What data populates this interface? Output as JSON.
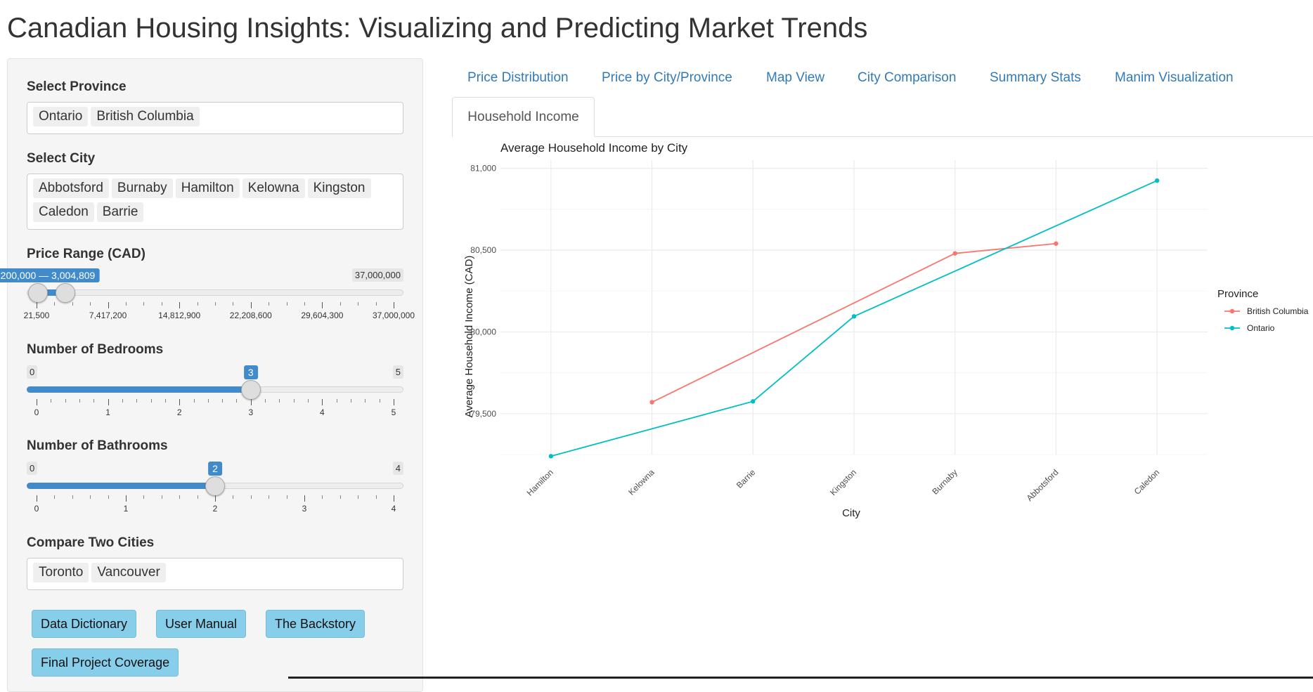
{
  "title": "Canadian Housing Insights: Visualizing and Predicting Market Trends",
  "sidebar": {
    "province": {
      "label": "Select Province",
      "selected": [
        "Ontario",
        "British Columbia"
      ]
    },
    "city": {
      "label": "Select City",
      "selected": [
        "Abbotsford",
        "Burnaby",
        "Hamilton",
        "Kelowna",
        "Kingston",
        "Caledon",
        "Barrie"
      ]
    },
    "price": {
      "label": "Price Range (CAD)",
      "bubble": "200,000 — 3,004,809",
      "max_label": "37,000,000",
      "min": 21500,
      "max": 37000000,
      "from": 200000,
      "to": 3004809,
      "ticks": [
        "21,500",
        "7,417,200",
        "14,812,900",
        "22,208,600",
        "29,604,300",
        "37,000,000"
      ]
    },
    "bedrooms": {
      "label": "Number of Bedrooms",
      "min_label": "0",
      "max_label": "5",
      "value_label": "3",
      "min": 0,
      "max": 5,
      "value": 3,
      "ticks": [
        "0",
        "1",
        "2",
        "3",
        "4",
        "5"
      ]
    },
    "bathrooms": {
      "label": "Number of Bathrooms",
      "min_label": "0",
      "max_label": "4",
      "value_label": "2",
      "min": 0,
      "max": 4,
      "value": 2,
      "ticks": [
        "0",
        "1",
        "2",
        "3",
        "4"
      ]
    },
    "compare": {
      "label": "Compare Two Cities",
      "selected": [
        "Toronto",
        "Vancouver"
      ]
    },
    "buttons": {
      "data_dictionary": "Data Dictionary",
      "user_manual": "User Manual",
      "backstory": "The Backstory",
      "final_project": "Final Project Coverage"
    }
  },
  "tabs": {
    "price_distribution": "Price Distribution",
    "price_by_city": "Price by City/Province",
    "map_view": "Map View",
    "city_comparison": "City Comparison",
    "summary_stats": "Summary Stats",
    "manim": "Manim Visualization",
    "household_income": "Household Income"
  },
  "colors": {
    "accent": "#428bca",
    "british_columbia": "#F8766D",
    "ontario": "#00BFC4",
    "button": "#87ceeb"
  },
  "chart_data": {
    "type": "line",
    "title": "Average Household Income by City",
    "xlabel": "City",
    "ylabel": "Average Household Income (CAD)",
    "categories": [
      "Hamilton",
      "Kelowna",
      "Barrie",
      "Kingston",
      "Burnaby",
      "Abbotsford",
      "Caledon"
    ],
    "ylim": [
      79250,
      81050
    ],
    "yticks": [
      79500,
      80000,
      80500,
      81000
    ],
    "ytick_labels": [
      "79,500",
      "80,000",
      "80,500",
      "81,000"
    ],
    "legend_title": "Province",
    "legend_position": "right",
    "grid": true,
    "series": [
      {
        "name": "British Columbia",
        "color": "#F8766D",
        "points": [
          {
            "x": "Kelowna",
            "y": 79570
          },
          {
            "x": "Burnaby",
            "y": 80480
          },
          {
            "x": "Abbotsford",
            "y": 80540
          }
        ]
      },
      {
        "name": "Ontario",
        "color": "#00BFC4",
        "points": [
          {
            "x": "Hamilton",
            "y": 79240
          },
          {
            "x": "Barrie",
            "y": 79575
          },
          {
            "x": "Kingston",
            "y": 80095
          },
          {
            "x": "Caledon",
            "y": 80925
          }
        ]
      }
    ]
  }
}
